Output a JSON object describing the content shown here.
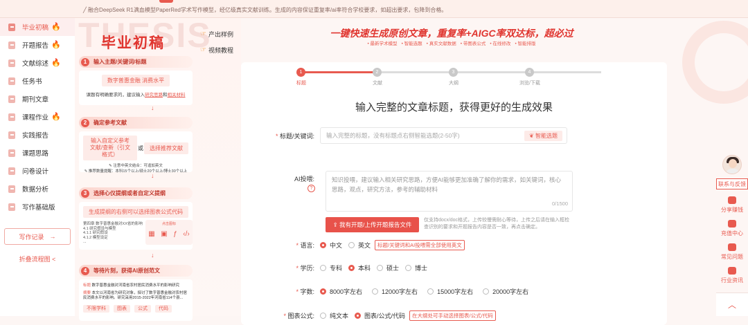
{
  "topbar": {
    "notice": "融合DeepSeek R1满血模型PaperRed学术写作模型，经亿级真实文献训练。生成的内容保证重复率/ai率符合学校要求，如超出要求，包降到合格。"
  },
  "sidebar": {
    "items": [
      {
        "label": "毕业初稿",
        "fire": "🔥"
      },
      {
        "label": "开题报告",
        "fire": "🔥"
      },
      {
        "label": "文献综述",
        "fire": "🔥"
      },
      {
        "label": "任务书",
        "fire": ""
      },
      {
        "label": "期刊文章",
        "fire": ""
      },
      {
        "label": "课程作业",
        "fire": "🔥"
      },
      {
        "label": "实践报告",
        "fire": ""
      },
      {
        "label": "课题思路",
        "fire": ""
      },
      {
        "label": "问卷设计",
        "fire": ""
      },
      {
        "label": "数据分析",
        "fire": ""
      },
      {
        "label": "写作基础版",
        "fire": ""
      }
    ],
    "record_btn": "写作记录",
    "record_arrow": "→",
    "fold": "折叠流程图 <"
  },
  "flow": {
    "bg_text": "THESIS",
    "title": "毕业初稿",
    "link_sample": "产出样例",
    "link_video": "视频教程",
    "steps": [
      {
        "num": "1",
        "title": "输入主题/关键词/标题",
        "tag": "数字普惠金融  消费水平",
        "note_pre": "课题有明确要求的，建议输入",
        "note_u1": "研究思路",
        "note_mid": "和",
        "note_u2": "相关材料"
      },
      {
        "num": "2",
        "title": "确定参考文献",
        "tag_a": "输入自定义参考文献/查新（引文格式）",
        "or": "或",
        "tag_b": "选择推荐文献",
        "note1": "注意中英文结合：可追加英文",
        "note2": "推荐数量提醒：本科15个以上/硕士20个以上/博士30个以上"
      },
      {
        "num": "3",
        "title": "选择心仪提纲或者自定义提纲",
        "tag": "生成提纲的右侧可以选择图表公式代码",
        "outline": [
          "第四章 数字普惠金融对XX省的影响",
          "4.1 研究假设与模型",
          "4.1.1 研究假设",
          "4.1.2 模型设定",
          "..."
        ],
        "badge": "点击图标"
      },
      {
        "num": "4",
        "title": "等待片刻，获得AI原创范文",
        "t_label": "标题",
        "t_text": "数字普惠金融对河南省农村居民消费水平的影响研究",
        "a_label": "摘要",
        "a_text": "本文以河南省为研究对象，探讨了数字普惠金融对农村居民消费水平的影响。研究采用2015-2022年河南省114个县...",
        "chips": [
          "不限学科",
          "图表",
          "公式",
          "代码"
        ]
      }
    ],
    "arrow": "↓"
  },
  "main": {
    "headline": "一键快速生成原创文章，重复率+AIGC率双达标，超必过",
    "bullets": [
      "• 最新学术模型",
      "• 智能选题",
      "• 真实文献数据",
      "• 带图表公式",
      "• 在线修改",
      "• 智能排版"
    ],
    "stepper": [
      {
        "n": "1",
        "label": "标题"
      },
      {
        "n": "2",
        "label": "文献"
      },
      {
        "n": "3",
        "label": "大纲"
      },
      {
        "n": "4",
        "label": "浏览/下载"
      }
    ],
    "panel_title": "输入完整的文章标题，获得更好的生成效果",
    "title_label": "标题/关键词:",
    "title_placeholder": "输入完整的标题，没有标题点右侧智能选题(2-50字)",
    "smart_btn": "❦ 智能选题",
    "ai_label": "AI投喂:",
    "ai_qmark": "?",
    "ai_placeholder": "知识投喂，建议输入相关研究思路，方便AI能够更加准确了解你的需求，如关键词，核心思路，观点，研究方法，参考的辅助材料",
    "ai_count": "0/1500",
    "upload_btn": "⇪ 我有开题/上传开题报告文件",
    "upload_hint": "仅支持docx/doc格式，上传较慢需耐心等待，上传之后请在输入框检查识别的要求和开题报告内容是否一致，再点击确定。",
    "language": {
      "label": "语言:",
      "options": [
        "中文",
        "英文"
      ],
      "selected": 0,
      "note": "标题/关键词和AI投喂需全部使用英文"
    },
    "degree": {
      "label": "学历:",
      "options": [
        "专科",
        "本科",
        "硕士",
        "博士"
      ],
      "selected": 1
    },
    "wordcount": {
      "label": "字数:",
      "options": [
        "8000字左右",
        "12000字左右",
        "15000字左右",
        "20000字左右"
      ],
      "selected": 0
    },
    "chart": {
      "label": "图表公式:",
      "options": [
        "纯文本",
        "图表/公式/代码"
      ],
      "selected": 1,
      "note": "在大纲处可手动选择图表/公式/代码"
    }
  },
  "rightbar": {
    "contact": "联系与反馈",
    "items": [
      "分享赚钱",
      "充值中心",
      "常见问题",
      "行业资讯"
    ],
    "up": "︿"
  },
  "colors": {
    "accent": "#e85a4f",
    "title_red": "#e0352f"
  }
}
